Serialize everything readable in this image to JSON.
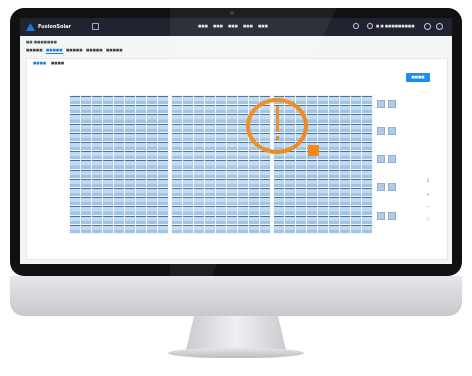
{
  "header": {
    "brand": "FusionSolar",
    "nav": [
      "■■■",
      "■■■",
      "■■■",
      "■■■",
      "■■■"
    ],
    "user_label": "■ ■ ■■■■",
    "account_label": "■■■■■"
  },
  "breadcrumb": "■■ ■■■■■■■",
  "tabs": [
    {
      "label": "■■■■■",
      "active": false
    },
    {
      "label": "■■■■■",
      "active": true
    },
    {
      "label": "■■■■■",
      "active": false
    },
    {
      "label": "■■■■■",
      "active": false
    },
    {
      "label": "■■■■■",
      "active": false
    }
  ],
  "sub_tabs": [
    {
      "label": "■■■■",
      "active": true
    },
    {
      "label": "■■■■",
      "active": false
    }
  ],
  "action_button": "■■■■ ■■■",
  "zoom_controls": [
    "2",
    "+",
    "−",
    "○"
  ],
  "colors": {
    "accent": "#1c8ef0",
    "warning": "#ee8a1e",
    "header_bg": "#1f2530",
    "module": "#9ec4e8"
  },
  "icons": {
    "warning": "warning-exclamation-icon",
    "logo": "fusionsolar-logo-icon"
  }
}
